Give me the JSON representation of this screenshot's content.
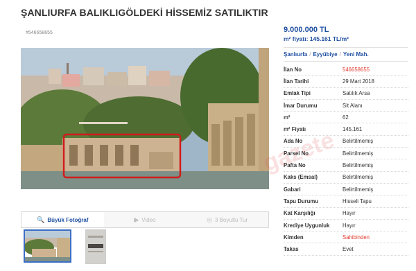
{
  "page": {
    "title": "ŞANLIURFA BALIKLIGÖLDEKİ HİSSEMİZ SATILIKTIR",
    "listing_ref": "#546658655"
  },
  "summary": {
    "price": "9.000.000 TL",
    "unit_price": "m² fiyatı: 145.161 TL/m²",
    "location": [
      "Şanlıurfa",
      "Eyyübiye",
      "Yeni Mah."
    ]
  },
  "details": [
    {
      "key": "İlan No",
      "value": "546658655",
      "color": "#e03a2f"
    },
    {
      "key": "İlan Tarihi",
      "value": "29 Mart 2018"
    },
    {
      "key": "Emlak Tipi",
      "value": "Satılık Arsa"
    },
    {
      "key": "İmar Durumu",
      "value": "Sit Alanı"
    },
    {
      "key": "m²",
      "value": "62"
    },
    {
      "key": "m² Fiyatı",
      "value": "145.161"
    },
    {
      "key": "Ada No",
      "value": "Belirtilmemiş"
    },
    {
      "key": "Parsel No",
      "value": "Belirtilmemiş"
    },
    {
      "key": "Pafta No",
      "value": "Belirtilmemiş"
    },
    {
      "key": "Kaks (Emsal)",
      "value": "Belirtilmemiş"
    },
    {
      "key": "Gabari",
      "value": "Belirtilmemiş"
    },
    {
      "key": "Tapu Durumu",
      "value": "Hisseli Tapu"
    },
    {
      "key": "Kat Karşılığı",
      "value": "Hayır"
    },
    {
      "key": "Krediye Uygunluk",
      "value": "Hayır"
    },
    {
      "key": "Kimden",
      "value": "Sahibinden",
      "color": "#e03a2f"
    },
    {
      "key": "Takas",
      "value": "Evet"
    }
  ],
  "gallery": {
    "tabs": [
      {
        "label": "Büyük Fotoğraf",
        "icon": "search-icon"
      },
      {
        "label": "Video",
        "icon": "video-icon"
      },
      {
        "label": "3 Boyutlu Tur",
        "icon": "tour-icon"
      }
    ]
  },
  "watermark": "gazete"
}
